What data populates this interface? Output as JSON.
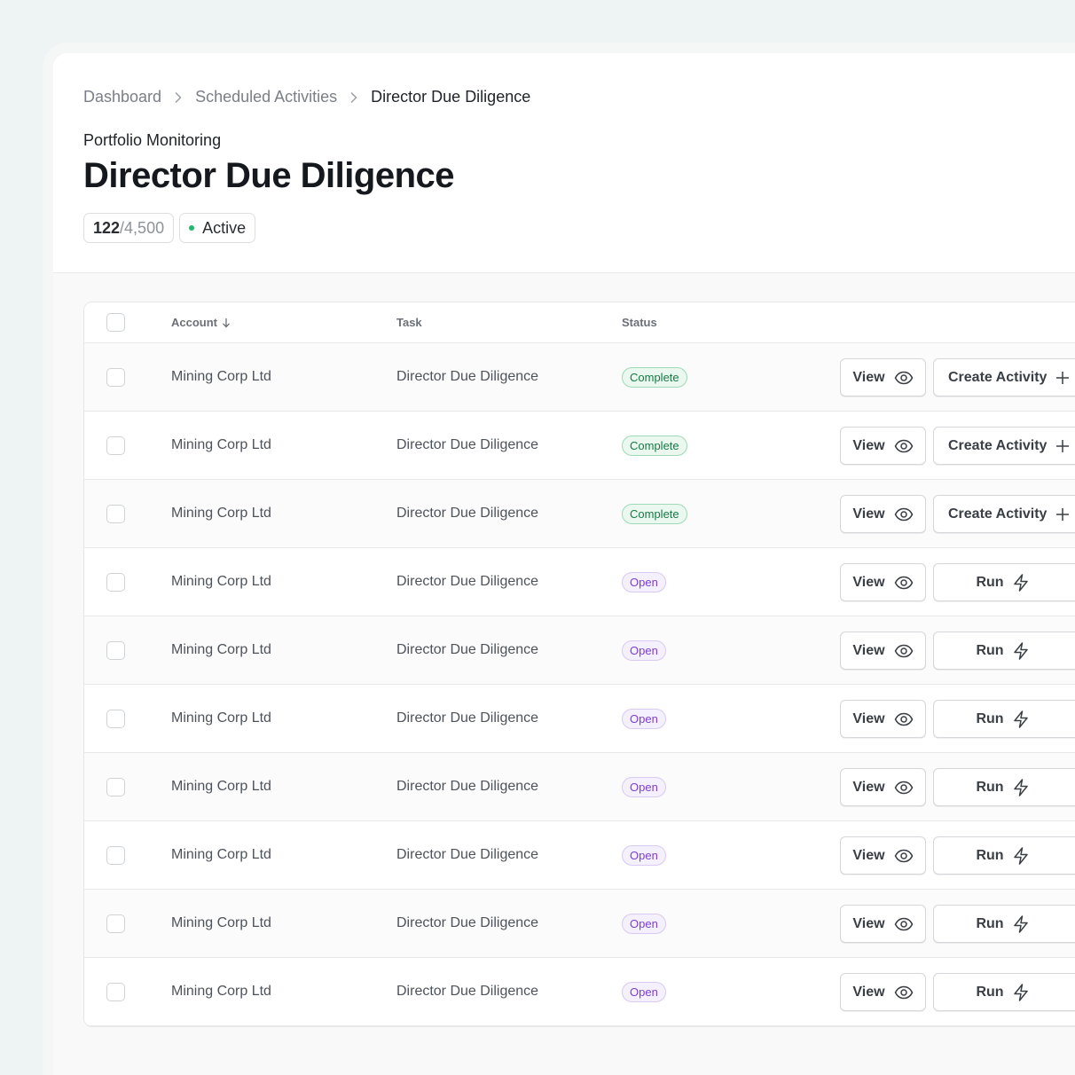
{
  "breadcrumb": {
    "items": [
      "Dashboard",
      "Scheduled Activities",
      "Director Due Diligence"
    ]
  },
  "header": {
    "subtitle": "Portfolio Monitoring",
    "title": "Director Due Diligence",
    "count": "122",
    "total": "/4,500",
    "status": "Active",
    "status_color": "#1db96a"
  },
  "table": {
    "columns": {
      "account": "Account",
      "task": "Task",
      "status": "Status"
    },
    "sort_icon": "arrow-down-icon",
    "rows": [
      {
        "account": "Mining Corp Ltd",
        "task": "Director Due Diligence",
        "status": "Complete",
        "view_label": "View",
        "action_label": "Create Activity",
        "action_icon": "plus-icon"
      },
      {
        "account": "Mining Corp Ltd",
        "task": "Director Due Diligence",
        "status": "Complete",
        "view_label": "View",
        "action_label": "Create Activity",
        "action_icon": "plus-icon"
      },
      {
        "account": "Mining Corp Ltd",
        "task": "Director Due Diligence",
        "status": "Complete",
        "view_label": "View",
        "action_label": "Create Activity",
        "action_icon": "plus-icon"
      },
      {
        "account": "Mining Corp Ltd",
        "task": "Director Due Diligence",
        "status": "Open",
        "view_label": "View",
        "action_label": "Run",
        "action_icon": "lightning-icon"
      },
      {
        "account": "Mining Corp Ltd",
        "task": "Director Due Diligence",
        "status": "Open",
        "view_label": "View",
        "action_label": "Run",
        "action_icon": "lightning-icon"
      },
      {
        "account": "Mining Corp Ltd",
        "task": "Director Due Diligence",
        "status": "Open",
        "view_label": "View",
        "action_label": "Run",
        "action_icon": "lightning-icon"
      },
      {
        "account": "Mining Corp Ltd",
        "task": "Director Due Diligence",
        "status": "Open",
        "view_label": "View",
        "action_label": "Run",
        "action_icon": "lightning-icon"
      },
      {
        "account": "Mining Corp Ltd",
        "task": "Director Due Diligence",
        "status": "Open",
        "view_label": "View",
        "action_label": "Run",
        "action_icon": "lightning-icon"
      },
      {
        "account": "Mining Corp Ltd",
        "task": "Director Due Diligence",
        "status": "Open",
        "view_label": "View",
        "action_label": "Run",
        "action_icon": "lightning-icon"
      },
      {
        "account": "Mining Corp Ltd",
        "task": "Director Due Diligence",
        "status": "Open",
        "view_label": "View",
        "action_label": "Run",
        "action_icon": "lightning-icon"
      }
    ]
  },
  "colors": {
    "complete_text": "#177a45",
    "open_text": "#7b3fd3",
    "accent_green": "#1db96a"
  }
}
